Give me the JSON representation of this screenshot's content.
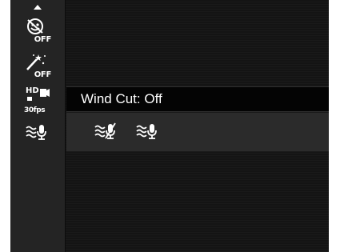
{
  "sidebar": {
    "items": [
      {
        "name": "face-detection-off",
        "badge": "OFF"
      },
      {
        "name": "effect-off",
        "badge": "OFF"
      },
      {
        "name": "movie-size",
        "hd": "HD",
        "fps": "30fps"
      },
      {
        "name": "wind-cut"
      }
    ]
  },
  "menu": {
    "title": "Wind Cut: Off"
  },
  "options": [
    {
      "name": "wind-cut-on"
    },
    {
      "name": "wind-cut-off"
    }
  ]
}
